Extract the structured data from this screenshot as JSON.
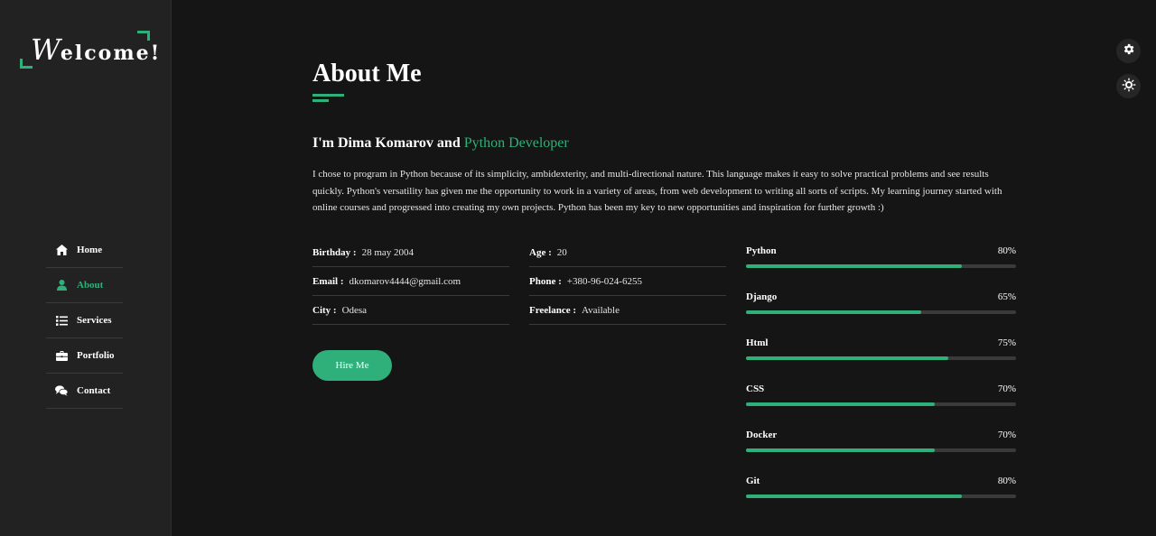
{
  "logo": {
    "first_letter": "W",
    "rest": "elcome!"
  },
  "nav": {
    "items": [
      {
        "label": "Home",
        "icon": "home-icon"
      },
      {
        "label": "About",
        "icon": "user-icon",
        "active": true
      },
      {
        "label": "Services",
        "icon": "list-icon"
      },
      {
        "label": "Portfolio",
        "icon": "briefcase-icon"
      },
      {
        "label": "Contact",
        "icon": "chat-icon"
      }
    ]
  },
  "about": {
    "title": "About Me",
    "intro_prefix": "I'm Dima Komarov and",
    "intro_role": "Python Developer",
    "bio": "I chose to program in Python because of its simplicity, ambidexterity, and multi-directional nature. This language makes it easy to solve practical problems and see results quickly. Python's versatility has given me the opportunity to work in a variety of areas, from web development to writing all sorts of scripts. My learning journey started with online courses and progressed into creating my own projects. Python has been my key to new opportunities and inspiration for further growth :)",
    "info_col1": [
      {
        "key": "Birthday :",
        "value": "28 may 2004"
      },
      {
        "key": "Email :",
        "value": "dkomarov4444@gmail.com"
      },
      {
        "key": "City :",
        "value": "Odesa"
      }
    ],
    "info_col2": [
      {
        "key": "Age :",
        "value": "20"
      },
      {
        "key": "Phone :",
        "value": "+380-96-024-6255"
      },
      {
        "key": "Freelance :",
        "value": "Available"
      }
    ],
    "hire_label": "Hire Me"
  },
  "skills": [
    {
      "name": "Python",
      "percent_label": "80%",
      "value": 80
    },
    {
      "name": "Django",
      "percent_label": "65%",
      "value": 65
    },
    {
      "name": "Html",
      "percent_label": "75%",
      "value": 75
    },
    {
      "name": "CSS",
      "percent_label": "70%",
      "value": 70
    },
    {
      "name": "Docker",
      "percent_label": "70%",
      "value": 70
    },
    {
      "name": "Git",
      "percent_label": "80%",
      "value": 80
    }
  ],
  "colors": {
    "accent": "#2fb07a",
    "background": "#151515",
    "sidebar": "#222222"
  },
  "settings_buttons": [
    "gear-icon",
    "sun-icon"
  ]
}
